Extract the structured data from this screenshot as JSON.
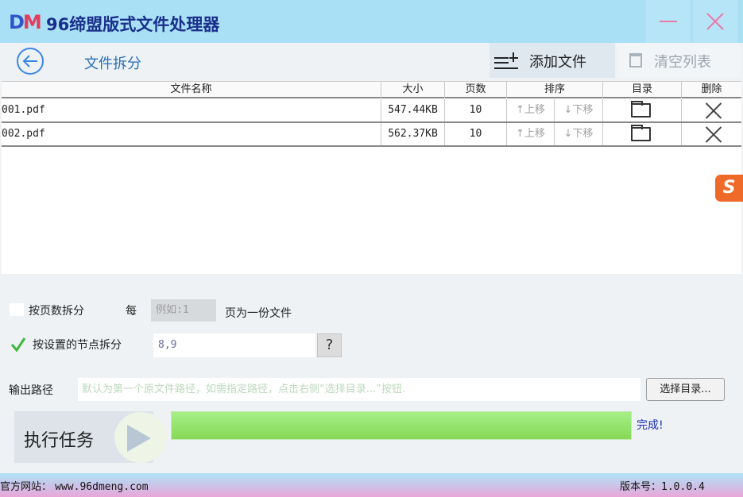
{
  "window": {
    "logo_d": "D",
    "logo_m": "M",
    "title": "96缔盟版式文件处理器"
  },
  "header": {
    "page_title": "文件拆分",
    "add_label": "添加文件",
    "clear_label": "清空列表"
  },
  "table": {
    "columns": [
      "文件名称",
      "大小",
      "页数",
      "排序",
      "目录",
      "删除"
    ],
    "rows": [
      {
        "name": "001.pdf",
        "size": "547.44KB",
        "pages": "10",
        "up": "↑上移",
        "down": "↓下移"
      },
      {
        "name": "002.pdf",
        "size": "562.37KB",
        "pages": "10",
        "up": "↑上移",
        "down": "↓下移"
      }
    ]
  },
  "options": {
    "by_pages_label": "按页数拆分",
    "every_label": "每",
    "pages_placeholder": "例如:1",
    "pages_suffix": "页为一份文件",
    "by_node_label": "按设置的节点拆分",
    "node_value": "8,9",
    "help_label": "?"
  },
  "output": {
    "label": "输出路径",
    "placeholder": "默认为第一个原文件路径，如需指定路径，点击右侧“选择目录...”按钮.",
    "pick_label": "选择目录..."
  },
  "run": {
    "label": "执行任务",
    "progress": 1.0,
    "status": "完成!"
  },
  "footer": {
    "site_label": "官方网站：",
    "site_url": "www.96dmeng.com",
    "version_label": "版本号：",
    "version": "1.0.0.4"
  },
  "colors": {
    "titlebar": "#a9e0f6",
    "accent": "#3a86e6",
    "progress": "#9ae57a"
  },
  "icons": [
    "back-arrow-icon",
    "add-list-icon",
    "trash-icon",
    "folder-icon",
    "close-icon",
    "check-icon",
    "play-icon"
  ]
}
